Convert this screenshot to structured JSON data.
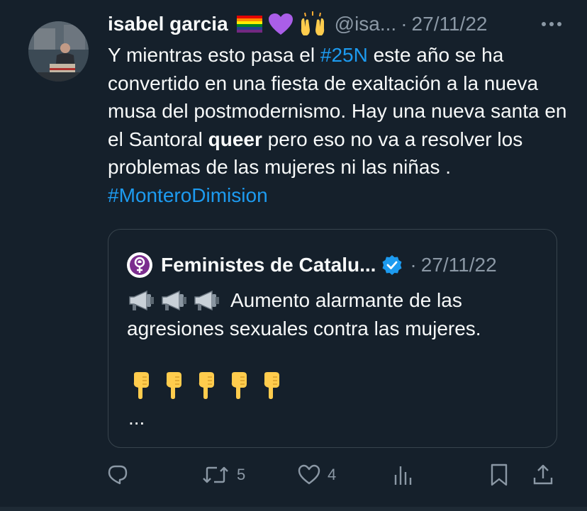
{
  "tweet": {
    "author_name": "isabel garcia",
    "author_emojis": [
      "rainbow-flag",
      "purple-heart",
      "raising-hands"
    ],
    "handle": "@isa...",
    "separator": "·",
    "date": "27/11/22",
    "text_parts": {
      "p1": "Y mientras esto pasa el ",
      "hashtag1": "#25N",
      "p2": " este año se ha convertido en una fiesta de exaltación a la nueva musa del postmodernismo. Hay una nueva santa en el Santoral ",
      "bold": "queer",
      "p3": " pero eso no va a resolver los problemas de las mujeres ni las niñas . ",
      "hashtag2": "#MonteroDimision"
    }
  },
  "quote": {
    "author_name": "Feministes de Catalu...",
    "verified_icon": "verified-badge-icon",
    "separator": "·",
    "date": "27/11/22",
    "text": "Aumento alarmante de las agresiones sexuales contra las mujeres.",
    "megaphone_count": 3,
    "pointing_down_count": 5,
    "ellipsis": "..."
  },
  "actions": {
    "reply_count": "",
    "retweet_count": "5",
    "like_count": "4"
  },
  "colors": {
    "background": "#15202b",
    "text": "#f7f9f9",
    "muted": "#8b98a5",
    "link": "#1d9bf0",
    "border": "#38444d"
  }
}
